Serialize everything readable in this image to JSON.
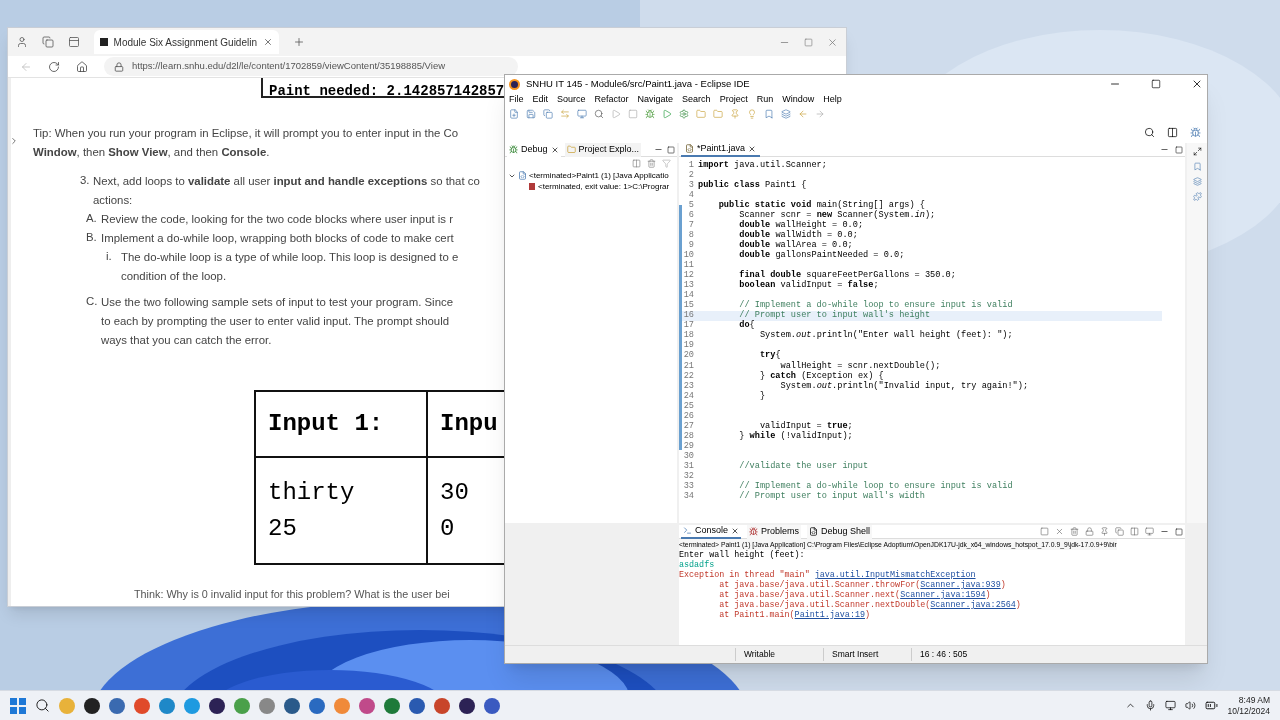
{
  "browser": {
    "tabs": [
      {
        "title": "Module Six Assignment Guidelin",
        "selected": true
      }
    ],
    "url": "https://learn.snhu.edu/d2l/le/content/1702859/viewContent/35198885/View",
    "page": {
      "output_line": "Paint needed: 2.142857142857",
      "tip": [
        "Tip: When you run your program in Eclipse, it will prompt you to enter input in the Co",
        "**Window**, then **Show View**, and then **Console**."
      ],
      "steps": [
        {
          "marker": "3.",
          "lines": [
            "Next, add loops to **validate** all user **input and handle exceptions** so that co",
            "actions:"
          ],
          "children": [
            {
              "marker": "A.",
              "lines": [
                "Review the code, looking for the two code blocks where user input is r"
              ]
            },
            {
              "marker": "B.",
              "lines": [
                "Implement a do-while loop, wrapping both blocks of code to make cert"
              ],
              "children": [
                {
                  "marker": "i.",
                  "lines": [
                    "The do-while loop is a type of while loop. This loop is designed to e",
                    "condition of the loop."
                  ]
                }
              ]
            },
            {
              "marker": "C.",
              "lines": [
                "Use the two following sample sets of input to test your program. Since",
                "to each by prompting the user to enter valid input. The prompt should",
                "ways that you can catch the error."
              ]
            }
          ]
        }
      ],
      "table": {
        "columns": [
          "Input 1:",
          "Inpu"
        ],
        "rows": [
          [
            [
              "thirty",
              "25"
            ],
            [
              "30",
              "0"
            ]
          ]
        ]
      },
      "think": "Think: Why is 0 invalid input for this problem? What is the user bei"
    }
  },
  "eclipse": {
    "title": "SNHU IT 145 - Module6/src/Paint1.java - Eclipse IDE",
    "menu": [
      "File",
      "Edit",
      "Source",
      "Refactor",
      "Navigate",
      "Search",
      "Project",
      "Run",
      "Window",
      "Help"
    ],
    "left_tabs": [
      {
        "label": "Debug",
        "selected": true
      },
      {
        "label": "Project Explo...",
        "selected": false
      }
    ],
    "tree": [
      {
        "label": "<terminated>Paint1 (1) [Java Applicatio",
        "children": [
          {
            "label": "<terminated, exit value: 1>C:\\Prograr"
          }
        ]
      }
    ],
    "editor_tabs": [
      {
        "label": "*Paint1.java",
        "selected": true
      }
    ],
    "code": [
      {
        "n": "1",
        "kind": "code",
        "current": false,
        "text": "**import** java.util.Scanner;"
      },
      {
        "n": "2",
        "current": false
      },
      {
        "n": "3",
        "kind": "code",
        "current": false,
        "text": "**public class** Paint1 {"
      },
      {
        "n": "4",
        "current": false
      },
      {
        "n": "5",
        "kind": "code",
        "current": false,
        "text": "    **public static void** main(String[] args) {"
      },
      {
        "n": "6",
        "kind": "code",
        "current": false,
        "text": "        Scanner scnr = **new** Scanner(System.*in*);"
      },
      {
        "n": "7",
        "kind": "code",
        "current": false,
        "text": "        **double** wallHeight = 0.0;"
      },
      {
        "n": "8",
        "kind": "code",
        "current": false,
        "text": "        **double** wallWidth = 0.0;"
      },
      {
        "n": "9",
        "kind": "code",
        "current": false,
        "text": "        **double** wallArea = 0.0;"
      },
      {
        "n": "10",
        "kind": "code",
        "current": false,
        "text": "        **double** gallonsPaintNeeded = 0.0;"
      },
      {
        "n": "11",
        "current": false
      },
      {
        "n": "12",
        "kind": "code",
        "current": false,
        "text": "        **final double** squareFeetPerGallons = 350.0;"
      },
      {
        "n": "13",
        "kind": "code",
        "current": false,
        "text": "        **boolean** validInput = **false**;"
      },
      {
        "n": "14",
        "current": false
      },
      {
        "n": "15",
        "kind": "comment",
        "current": false,
        "text": "        // Implement a do-while loop to ensure input is valid"
      },
      {
        "n": "16",
        "kind": "comment",
        "current": true,
        "text": "        // Prompt user to input wall's height"
      },
      {
        "n": "17",
        "kind": "code",
        "current": false,
        "text": "        **do**{"
      },
      {
        "n": "18",
        "kind": "code",
        "current": false,
        "text": "            System.*out*.println(\"Enter wall height (feet): \");"
      },
      {
        "n": "19",
        "current": false
      },
      {
        "n": "20",
        "kind": "code",
        "current": false,
        "text": "            **try**{"
      },
      {
        "n": "21",
        "kind": "code",
        "current": false,
        "text": "                wallHeight = scnr.nextDouble();"
      },
      {
        "n": "22",
        "kind": "code",
        "current": false,
        "text": "            } **catch** (Exception ex) {"
      },
      {
        "n": "23",
        "kind": "code",
        "current": false,
        "text": "                System.*out*.println(\"Invalid input, try again!\");"
      },
      {
        "n": "24",
        "kind": "code",
        "current": false,
        "text": "            }"
      },
      {
        "n": "25",
        "current": false
      },
      {
        "n": "26",
        "current": false
      },
      {
        "n": "27",
        "kind": "code",
        "current": false,
        "text": "            validInput = **true**;"
      },
      {
        "n": "28",
        "kind": "code",
        "current": false,
        "text": "        } **while** (!validInput);"
      },
      {
        "n": "29",
        "current": false
      },
      {
        "n": "30",
        "current": false
      },
      {
        "n": "31",
        "kind": "comment",
        "current": false,
        "text": "        //validate the user input"
      },
      {
        "n": "32",
        "current": false
      },
      {
        "n": "33",
        "kind": "comment",
        "current": false,
        "text": "        // Implement a do-while loop to ensure input is valid"
      },
      {
        "n": "34",
        "kind": "comment",
        "current": false,
        "text": "        // Prompt user to input wall's width"
      }
    ],
    "console_tabs": [
      {
        "label": "Console",
        "selected": true
      },
      {
        "label": "Problems",
        "selected": false
      },
      {
        "label": "Debug Shell",
        "selected": false
      }
    ],
    "console_header": "<terminated> Paint1 (1) [Java Application] C:\\Program Files\\Eclipse Adoptium\\OpenJDK17U-jdk_x64_windows_hotspot_17.0.9_9\\jdk-17.0.9+9\\bir",
    "console": [
      {
        "kind": "output",
        "parts": [
          {
            "text": "Enter wall height (feet):",
            "link": false
          }
        ]
      },
      {
        "kind": "input",
        "parts": [
          {
            "text": "asdadfs",
            "link": false
          }
        ]
      },
      {
        "kind": "error",
        "parts": [
          {
            "text": "Exception in thread \"main\" ",
            "link": false
          },
          {
            "text": "java.util.InputMismatchException",
            "link": true
          }
        ]
      },
      {
        "kind": "error",
        "parts": [
          {
            "text": "        at java.base/java.util.Scanner.throwFor(",
            "link": false
          },
          {
            "text": "Scanner.java:939",
            "link": true
          },
          {
            "text": ")",
            "link": false
          }
        ]
      },
      {
        "kind": "error",
        "parts": [
          {
            "text": "        at java.base/java.util.Scanner.next(",
            "link": false
          },
          {
            "text": "Scanner.java:1594",
            "link": true
          },
          {
            "text": ")",
            "link": false
          }
        ]
      },
      {
        "kind": "error",
        "parts": [
          {
            "text": "        at java.base/java.util.Scanner.nextDouble(",
            "link": false
          },
          {
            "text": "Scanner.java:2564",
            "link": true
          },
          {
            "text": ")",
            "link": false
          }
        ]
      },
      {
        "kind": "error",
        "parts": [
          {
            "text": "        at Paint1.main(",
            "link": false
          },
          {
            "text": "Paint1.java:19",
            "link": true
          },
          {
            "text": ")",
            "link": false
          }
        ]
      }
    ],
    "status": [
      "Writable",
      "Smart Insert",
      "16 : 46 : 505"
    ]
  },
  "taskbar": {
    "time": "8:49 AM",
    "date": "10/12/2024"
  }
}
